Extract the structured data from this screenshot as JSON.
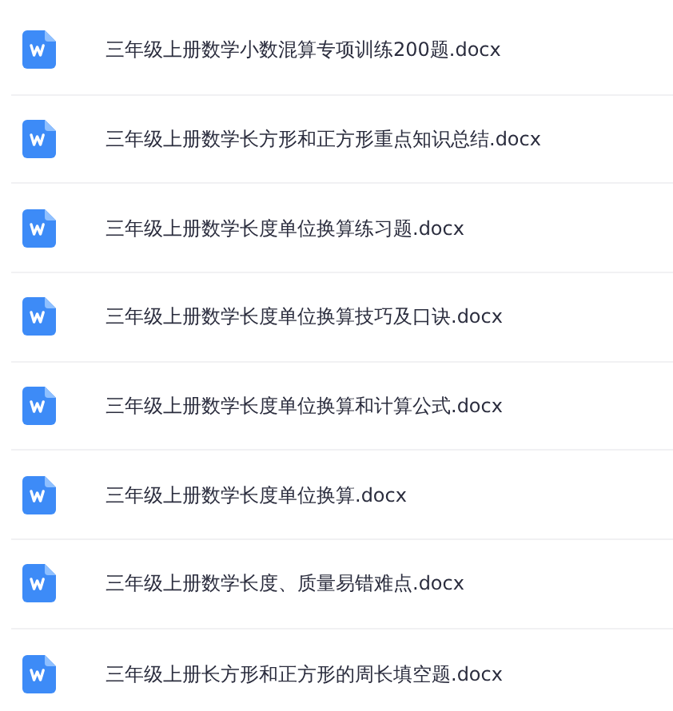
{
  "files": [
    {
      "name": "三年级上册数学小数混算专项训练200题.docx",
      "kind": "word"
    },
    {
      "name": "三年级上册数学长方形和正方形重点知识总结.docx",
      "kind": "word"
    },
    {
      "name": "三年级上册数学长度单位换算练习题.docx",
      "kind": "word"
    },
    {
      "name": "三年级上册数学长度单位换算技巧及口诀.docx",
      "kind": "word"
    },
    {
      "name": "三年级上册数学长度单位换算和计算公式.docx",
      "kind": "word"
    },
    {
      "name": "三年级上册数学长度单位换算.docx",
      "kind": "word"
    },
    {
      "name": "三年级上册数学长度、质量易错难点.docx",
      "kind": "word"
    },
    {
      "name": "三年级上册长方形和正方形的周长填空题.docx",
      "kind": "word"
    }
  ]
}
